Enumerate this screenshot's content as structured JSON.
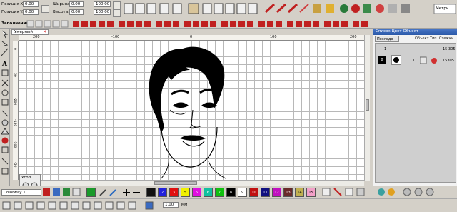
{
  "toolbar_top": {
    "pos_x_label": "Позиция X:",
    "pos_y_label": "Позиция Y:",
    "pos_x_value": "0.00",
    "pos_y_value": "0.00",
    "width_label": "Ширина:",
    "height_label": "Высота:",
    "width_value": "0.00",
    "height_value": "0.00",
    "width_pct": "100.00",
    "height_pct": "100.00",
    "metric_label": "Метри"
  },
  "fill_bar": {
    "label": "Заполнения:"
  },
  "document": {
    "tab_title": "Умерный",
    "close_glyph": "✕"
  },
  "ruler": {
    "h_labels": [
      "200",
      "-100",
      "0",
      "100",
      "200"
    ],
    "v_labels": [
      "0",
      "50",
      "-200",
      "-150",
      "-100",
      "-50"
    ]
  },
  "object_panel": {
    "title": "Список Цвет-Объект",
    "tab_sequence": "Последо",
    "col_object": "Объект",
    "col_type": "Тип",
    "col_stitches": "Стежки",
    "rows": [
      {
        "index": "1",
        "stitches": "15 305"
      },
      {
        "num": "8",
        "index": "1",
        "stitches": "15305"
      }
    ]
  },
  "angle_box": {
    "label": "Угол"
  },
  "colorway": {
    "label": "Colorway 1"
  },
  "palette": [
    {
      "num": "1",
      "color": "#1a9a2a"
    },
    {
      "num": "1",
      "color": "#111111"
    },
    {
      "num": "2",
      "color": "#2222dd"
    },
    {
      "num": "3",
      "color": "#e01010"
    },
    {
      "num": "5",
      "color": "#f0f000"
    },
    {
      "num": "6",
      "color": "#e010e0"
    },
    {
      "num": "6",
      "color": "#10c0a0"
    },
    {
      "num": "7",
      "color": "#10c010"
    },
    {
      "num": "8",
      "color": "#000000"
    },
    {
      "num": "9",
      "color": "#ffffff"
    },
    {
      "num": "10",
      "color": "#c01010"
    },
    {
      "num": "11",
      "color": "#101080"
    },
    {
      "num": "12",
      "color": "#c010c0"
    },
    {
      "num": "13",
      "color": "#6a2a2a"
    },
    {
      "num": "14",
      "color": "#c0b050"
    },
    {
      "num": "15",
      "color": "#f2a0c8"
    }
  ],
  "bottom_bar": {
    "stitch_length": "1.00",
    "unit": "мм"
  }
}
